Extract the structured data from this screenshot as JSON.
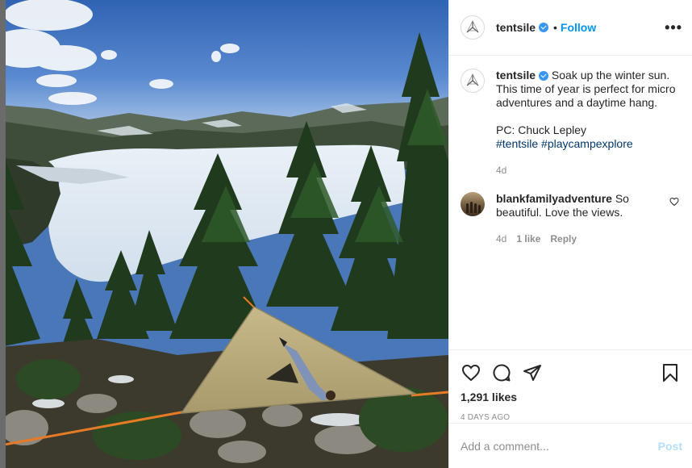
{
  "post": {
    "username": "tentsile",
    "follow_separator": "•",
    "follow_label": "Follow",
    "more_label": "•••",
    "caption": {
      "username": "tentsile",
      "text": "Soak up the winter sun. This time of year is perfect for micro adventures and a daytime hang.",
      "credit": "PC: Chuck Lepley",
      "hashtags": [
        "#tentsile",
        "#playcampexplore"
      ],
      "age": "4d"
    },
    "comments": [
      {
        "username": "blankfamilyadventure",
        "text": "So beautiful. Love the views.",
        "age": "4d",
        "likes": "1 like",
        "reply_label": "Reply"
      }
    ],
    "likes": "1,291 likes",
    "date": "4 DAYS AGO",
    "add_comment": {
      "placeholder": "Add a comment...",
      "post_label": "Post"
    }
  },
  "icons": {
    "like": "heart-icon",
    "comment": "comment-icon",
    "share": "paper-plane-icon",
    "save": "bookmark-icon",
    "comment_like": "heart-small-icon",
    "verified": "verified-badge-icon",
    "more": "more-options-icon"
  },
  "colors": {
    "follow": "#0095f6",
    "verified": "#3897f0",
    "hashtag": "#00376b",
    "muted": "#8e8e8e",
    "post_disabled": "#b2dffc",
    "border": "#efefef"
  }
}
